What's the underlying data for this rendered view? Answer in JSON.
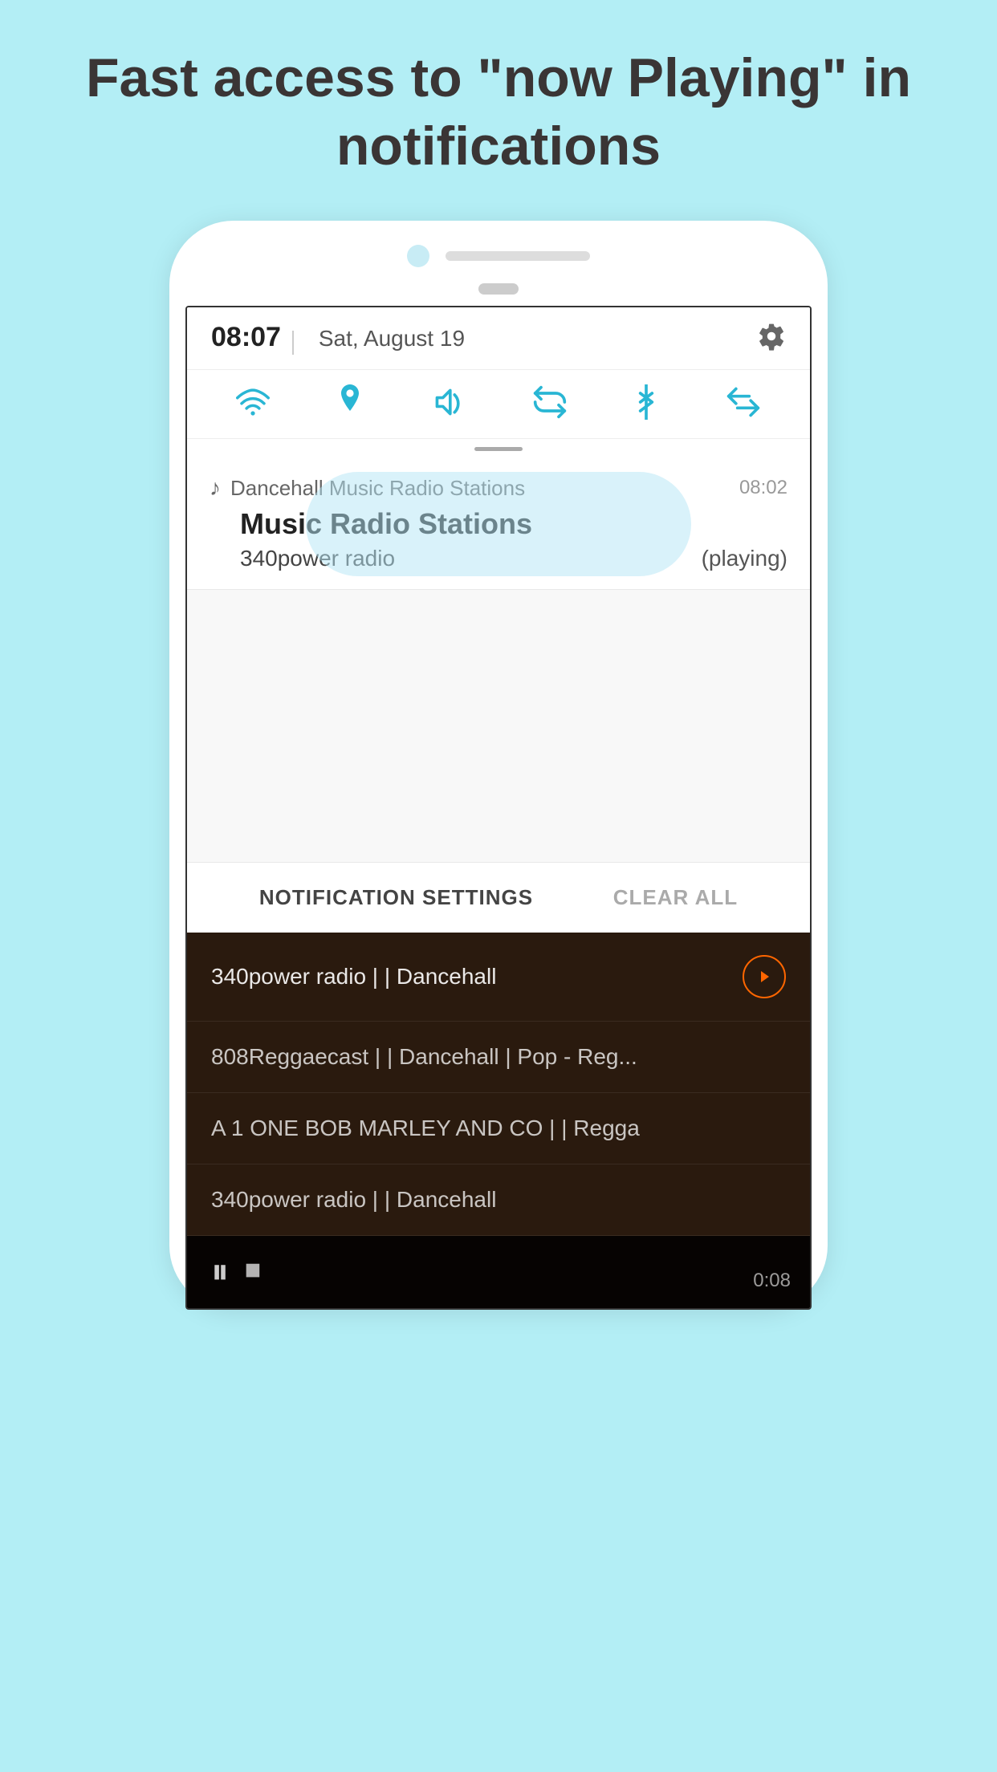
{
  "header": {
    "title": "Fast access to \"now Playing\" in notifications"
  },
  "phone": {
    "statusBar": {
      "time": "08:07",
      "separator": "|",
      "date": "Sat, August 19"
    },
    "quickSettings": {
      "icons": [
        "wifi",
        "location",
        "sound",
        "sync",
        "bluetooth",
        "arrows"
      ]
    },
    "notification": {
      "appIcon": "♪",
      "appName": "Dancehall Music Radio Stations",
      "time": "08:02",
      "title": "Music Radio Stations",
      "station": "340power radio",
      "status": "(playing)"
    },
    "footer": {
      "settingsLabel": "NOTIFICATION SETTINGS",
      "clearLabel": "CLEAR ALL"
    }
  },
  "radioList": {
    "items": [
      {
        "label": "340power radio | | Dancehall",
        "active": true,
        "hasPlayBtn": true
      },
      {
        "label": "808Reggaecast | | Dancehall | Pop - Reg...",
        "active": false,
        "hasPlayBtn": false
      },
      {
        "label": "A 1 ONE BOB MARLEY AND CO | | Regga",
        "active": false,
        "hasPlayBtn": false
      },
      {
        "label": "340power radio | | Dancehall",
        "active": false,
        "hasPlayBtn": false
      }
    ]
  },
  "player": {
    "pauseIcon": "⏸",
    "stopIcon": "⏹",
    "time": "0:08"
  }
}
